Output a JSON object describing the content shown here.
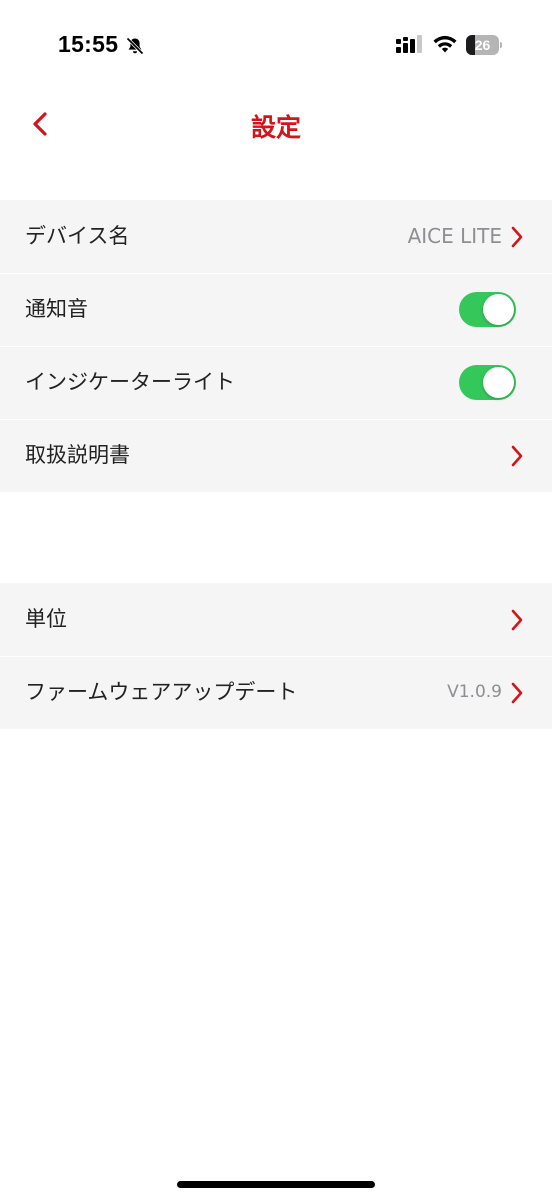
{
  "status_bar": {
    "time": "15:55",
    "battery_level": "26",
    "battery_fraction": 0.26,
    "icons": [
      "bell-off-icon",
      "cellular-signal-icon",
      "wifi-icon",
      "battery-icon"
    ]
  },
  "nav": {
    "title": "設定",
    "back_icon": "chevron-left-icon"
  },
  "section1": {
    "device_name": {
      "label": "デバイス名",
      "value": "AICE LITE"
    },
    "notification_sound": {
      "label": "通知音",
      "enabled": true
    },
    "indicator_light": {
      "label": "インジケーターライト",
      "enabled": true
    },
    "manual": {
      "label": "取扱説明書"
    }
  },
  "section2": {
    "unit": {
      "label": "単位"
    },
    "firmware_update": {
      "label": "ファームウェアアップデート",
      "value": "V1.0.9"
    }
  },
  "colors": {
    "accent": "#d4141a",
    "toggle_on": "#34c759",
    "group_background": "#f5f5f5",
    "secondary_text": "#8e8e93"
  }
}
